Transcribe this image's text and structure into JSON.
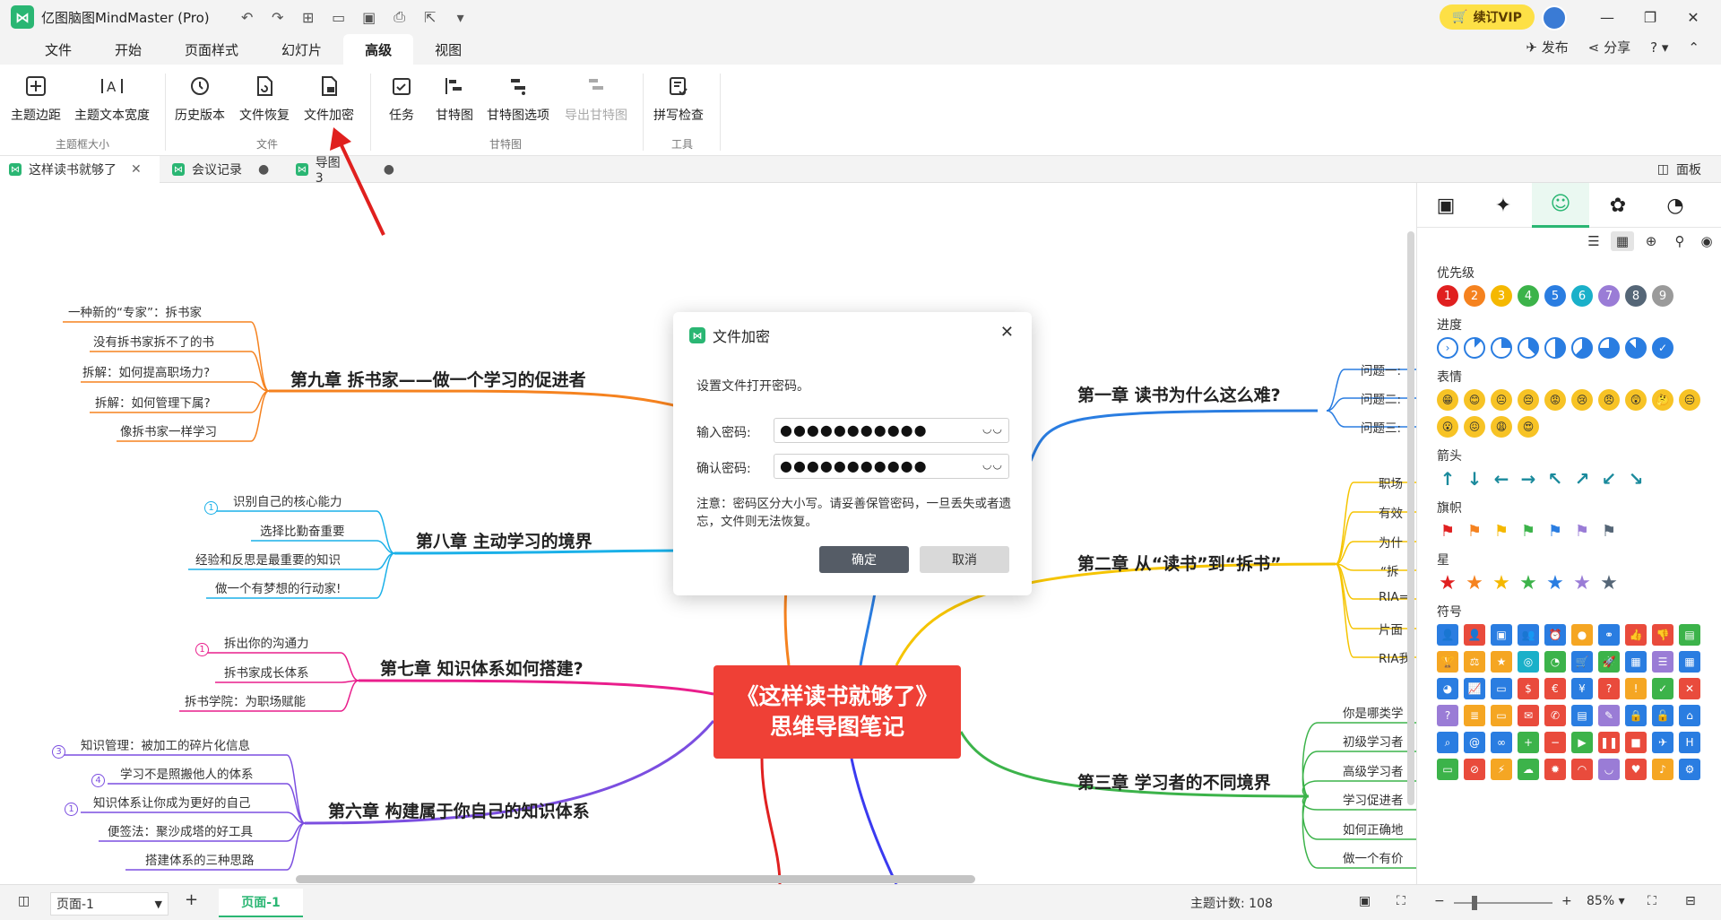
{
  "app": {
    "title": "亿图脑图MindMaster (Pro)",
    "vip_label": "续订VIP"
  },
  "menu": {
    "items": [
      "文件",
      "开始",
      "页面样式",
      "幻灯片",
      "高级",
      "视图"
    ],
    "active": "高级",
    "publish": "发布",
    "share": "分享",
    "help": "?"
  },
  "ribbon": {
    "buttons": [
      "主题边距",
      "主题文本宽度",
      "历史版本",
      "文件恢复",
      "文件加密",
      "任务",
      "甘特图",
      "甘特图选项",
      "导出甘特图",
      "拼写检查"
    ],
    "groups": [
      "主题框大小",
      "文件",
      "甘特图",
      "工具"
    ]
  },
  "doc_tabs": [
    "这样读书就够了",
    "会议记录",
    "导图3"
  ],
  "panel_label": "面板",
  "mindmap": {
    "central": [
      "《这样读书就够了》",
      "思维导图笔记"
    ],
    "branches": {
      "ch9": "第九章 拆书家——做一个学习的促进者",
      "ch8": "第八章 主动学习的境界",
      "ch7": "第七章 知识体系如何搭建?",
      "ch6": "第六章 构建属于你自己的知识体系",
      "ch1": "第一章 读书为什么这么难?",
      "ch2": "第二章 从“读书”到“拆书”",
      "ch3": "第三章 学习者的不同境界"
    },
    "leaves": {
      "ch9": [
        "一种新的“专家”：拆书家",
        "没有拆书家拆不了的书",
        "拆解：如何提高职场力?",
        "拆解：如何管理下属?",
        "像拆书家一样学习"
      ],
      "ch8": [
        "识别自己的核心能力",
        "选择比勤奋重要",
        "经验和反思是最重要的知识",
        "做一个有梦想的行动家!"
      ],
      "ch7": [
        "拆出你的沟通力",
        "拆书家成长体系",
        "拆书学院：为职场赋能"
      ],
      "ch6": [
        "知识管理：被加工的碎片化信息",
        "学习不是照搬他人的体系",
        "知识体系让你成为更好的自己",
        "便签法：聚沙成塔的好工具",
        "搭建体系的三种思路"
      ],
      "ch1": [
        "问题一:",
        "问题二:",
        "问题三:"
      ],
      "ch2": [
        "职场",
        "有效",
        "为什",
        "“拆",
        "RIA=",
        "片面",
        "RIA我"
      ],
      "ch3": [
        "你是哪类学",
        "初级学习者",
        "高级学习者",
        "学习促进者",
        "如何正确地",
        "做一个有价"
      ]
    },
    "badges": {
      "ch8": "1",
      "ch7": "1",
      "ch6": [
        "3",
        "4",
        "1"
      ]
    }
  },
  "dialog": {
    "title": "文件加密",
    "desc": "设置文件打开密码。",
    "pwd_label": "输入密码:",
    "confirm_label": "确认密码:",
    "pwd_value": "●●●●●●●●●●●",
    "confirm_value": "●●●●●●●●●●●",
    "note": "注意：密码区分大小写。请妥善保管密码，一旦丢失或者遗忘，文件则无法恢复。",
    "ok": "确定",
    "cancel": "取消"
  },
  "panel": {
    "sections": [
      "优先级",
      "进度",
      "表情",
      "箭头",
      "旗帜",
      "星",
      "符号"
    ],
    "priority": [
      "1",
      "2",
      "3",
      "4",
      "5",
      "6",
      "7",
      "8",
      "9"
    ],
    "priority_colors": [
      "#e02020",
      "#f5821f",
      "#f5b800",
      "#3cb34a",
      "#2a7de1",
      "#1ab0c9",
      "#9a7cd6",
      "#556677",
      "#9a9a9a"
    ],
    "flag_colors": [
      "#e02020",
      "#f5821f",
      "#f5b800",
      "#3cb34a",
      "#2a7de1",
      "#9a7cd6",
      "#556677"
    ],
    "star_colors": [
      "#e02020",
      "#f5821f",
      "#f5b800",
      "#3cb34a",
      "#2a7de1",
      "#9a7cd6",
      "#556677"
    ]
  },
  "status": {
    "page_select": "页面-1",
    "page_tab": "页面-1",
    "topic_count_label": "主题计数:",
    "topic_count": "108",
    "zoom": "85%"
  }
}
